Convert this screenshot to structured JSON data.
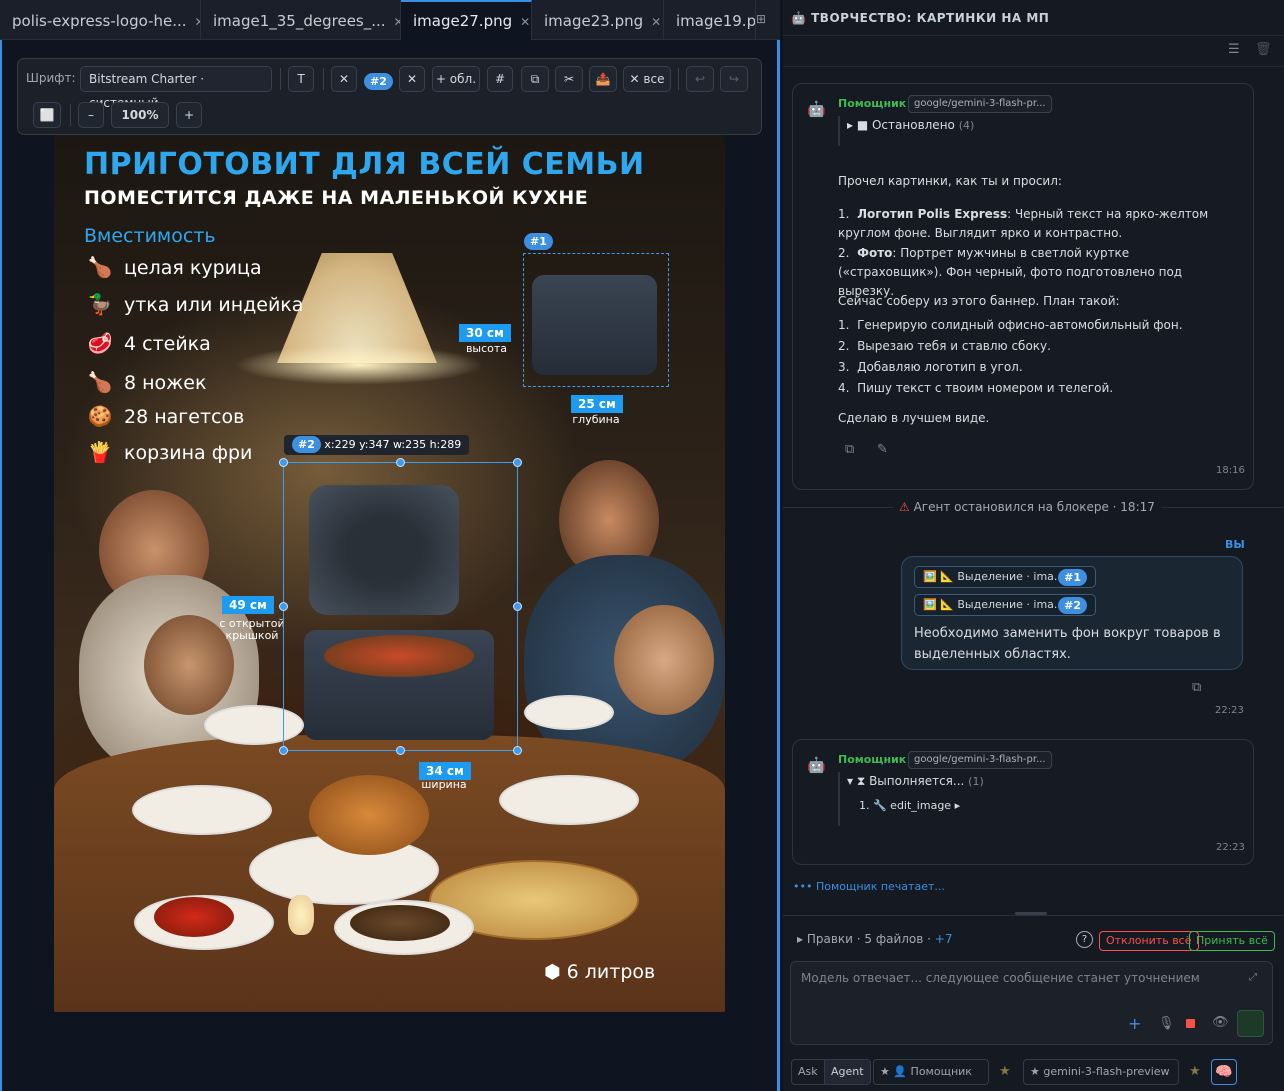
{
  "tabs": [
    {
      "label": "polis-express-logo-he..."
    },
    {
      "label": "image1_35_degrees_..."
    },
    {
      "label": "image27.png"
    },
    {
      "label": "image23.png"
    },
    {
      "label": "image19.p"
    }
  ],
  "toolbar": {
    "font_label": "Шрифт:",
    "font_value": "Bitstream Charter · системный",
    "text_btn": "T",
    "clear_btn": "✕",
    "sel_badge": "#2",
    "sel_clear": "✕",
    "add_area": "+ обл.",
    "grid": "#",
    "copy": "⧉",
    "cut": "✂",
    "export": "📤",
    "clear_all": "✕ все",
    "undo": "↩",
    "redo": "↪",
    "frame": "⬜",
    "zoom_out": "–",
    "zoom": "100%",
    "zoom_in": "+"
  },
  "poster": {
    "title": "ПРИГОТОВИТ ДЛЯ ВСЕЙ СЕМЬИ",
    "subtitle": "ПОМЕСТИТСЯ  ДАЖЕ НА МАЛЕНЬКОЙ КУХНЕ",
    "capacity": "Вместимость",
    "items": [
      {
        "icon": "🍗",
        "text": "целая курица"
      },
      {
        "icon": "🦆",
        "text": "утка или индейка"
      },
      {
        "icon": "🥩",
        "text": "4 стейка"
      },
      {
        "icon": "🍗",
        "text": "8 ножек"
      },
      {
        "icon": "🍪",
        "text": "28 нагетсов"
      },
      {
        "icon": "🍟",
        "text": "корзина фри"
      }
    ],
    "liters": "6 литров",
    "sel1_badge": "#1",
    "sel2_badge": "#2",
    "sel2_info": "x:229 y:347 w:235 h:289",
    "dim_height": "30 см",
    "dim_height_sub": "высота",
    "dim_depth": "25 см",
    "dim_depth_sub": "глубина",
    "dim_open": "49 см",
    "dim_open_sub": "с открытой крышкой",
    "dim_width": "34 см",
    "dim_width_sub": "ширина"
  },
  "chat": {
    "header": "🤖 ТВОРЧЕСТВО: КАРТИНКИ НА МП",
    "assistant_name": "Помощник",
    "model": "google/gemini-3-flash-pr...",
    "stopped": "▸ ■ Остановлено",
    "stopped_count": "(4)",
    "m1_intro": "Прочел картинки, как ты и просил:",
    "m1_li1_b": "Логотип Polis Express",
    "m1_li1": ": Черный текст на ярко-желтом круглом фоне. Выглядит ярко и контрастно.",
    "m1_li2_b": "Фото",
    "m1_li2": ": Портрет мужчины в светлой куртке («страховщик»). Фон черный, фото подготовлено под вырезку.",
    "m1_plan": "Сейчас соберу из этого баннер. План такой:",
    "m1_steps": [
      "Генерирую солидный офисно-автомобильный фон.",
      "Вырезаю тебя и ставлю сбоку.",
      "Добавляю логотип в угол.",
      "Пишу текст с твоим номером и телегой."
    ],
    "m1_end": "Сделаю в лучшем виде.",
    "m1_time": "18:16",
    "blocker": "Агент остановился на блокере",
    "blocker_time": "· 18:17",
    "you": "ВЫ",
    "chip1": "🖼️ 📐 Выделение · ima...",
    "chip1_badge": "#1",
    "chip2": "🖼️ 📐 Выделение · ima...",
    "chip2_badge": "#2",
    "user_text": "Необходимо заменить фон вокруг товаров в выделенных областях.",
    "user_time": "22:23",
    "running": "▾ ⧗ Выполняется...",
    "running_count": "(1)",
    "tool": "1. 🔧 edit_image ▸",
    "m2_time": "22:23",
    "typing": "Помощник печатает...",
    "edits": "▸ Правки · 5 файлов ·",
    "edits_plus": "+7",
    "help": "?",
    "reject": "Отклонить всё",
    "accept": "Принять всё",
    "placeholder": "Модель отвечает... следующее сообщение станет уточнением",
    "mode_ask": "Ask",
    "mode_agent": "Agent",
    "role": "★ 👤 Помощник",
    "model_sel": "★ gemini-3-flash-preview"
  }
}
